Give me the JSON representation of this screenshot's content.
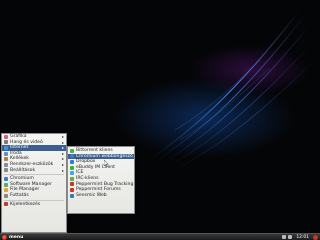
{
  "menu": {
    "items": [
      {
        "label": "Grafika",
        "icon": "graphics-icon",
        "color": "#d95a8a",
        "submenu": true
      },
      {
        "label": "Hang és videó",
        "icon": "multimedia-icon",
        "color": "#7a7a7a",
        "submenu": true
      },
      {
        "label": "Internet",
        "icon": "internet-icon",
        "color": "#4a90d9",
        "submenu": true,
        "active": true
      },
      {
        "label": "Iroda",
        "icon": "office-icon",
        "color": "#5b8fd1",
        "submenu": true
      },
      {
        "label": "Kellékek",
        "icon": "accessories-icon",
        "color": "#b47a3c",
        "submenu": true
      },
      {
        "label": "Rendszer-eszközök",
        "icon": "system-tools-icon",
        "color": "#7b8fa8",
        "submenu": true
      },
      {
        "label": "Beállítások",
        "icon": "settings-icon",
        "color": "#8a8a8a",
        "submenu": true
      }
    ],
    "apps": [
      {
        "label": "Chromium",
        "icon": "chromium-icon",
        "color": "#3a7bd5"
      },
      {
        "label": "Software Manager",
        "icon": "software-manager-icon",
        "color": "#6aa84f"
      },
      {
        "label": "File Manager",
        "icon": "file-manager-icon",
        "color": "#d9a441"
      },
      {
        "label": "Futtatás",
        "icon": "run-icon",
        "color": "#888888"
      }
    ],
    "logout": {
      "label": "Kijelentkezés",
      "icon": "logout-icon",
      "color": "#c0392b"
    }
  },
  "submenu": {
    "items": [
      {
        "label": "Bittorrent kliens",
        "icon": "bittorrent-icon",
        "color": "#4caf50"
      },
      {
        "label": "Chromium webböngésző",
        "icon": "chromium-icon",
        "color": "#3a7bd5",
        "active": true
      },
      {
        "label": "Dropbox",
        "icon": "dropbox-icon",
        "color": "#2b7fd6"
      },
      {
        "label": "eBuddy IM Client",
        "icon": "ebuddy-icon",
        "color": "#3cb043"
      },
      {
        "label": "ICE",
        "icon": "ice-icon",
        "color": "#4aa3df"
      },
      {
        "label": "IRC-kliens",
        "icon": "irc-icon",
        "color": "#6aa84f"
      },
      {
        "label": "Peppermint Bug Tracking",
        "icon": "peppermint-icon",
        "color": "#c0392b"
      },
      {
        "label": "Peppermint Forums",
        "icon": "peppermint-icon",
        "color": "#c0392b"
      },
      {
        "label": "Seesmic Web",
        "icon": "seesmic-icon",
        "color": "#2980b9"
      }
    ]
  },
  "taskbar": {
    "start_label": "menu",
    "clock": "12:01"
  }
}
